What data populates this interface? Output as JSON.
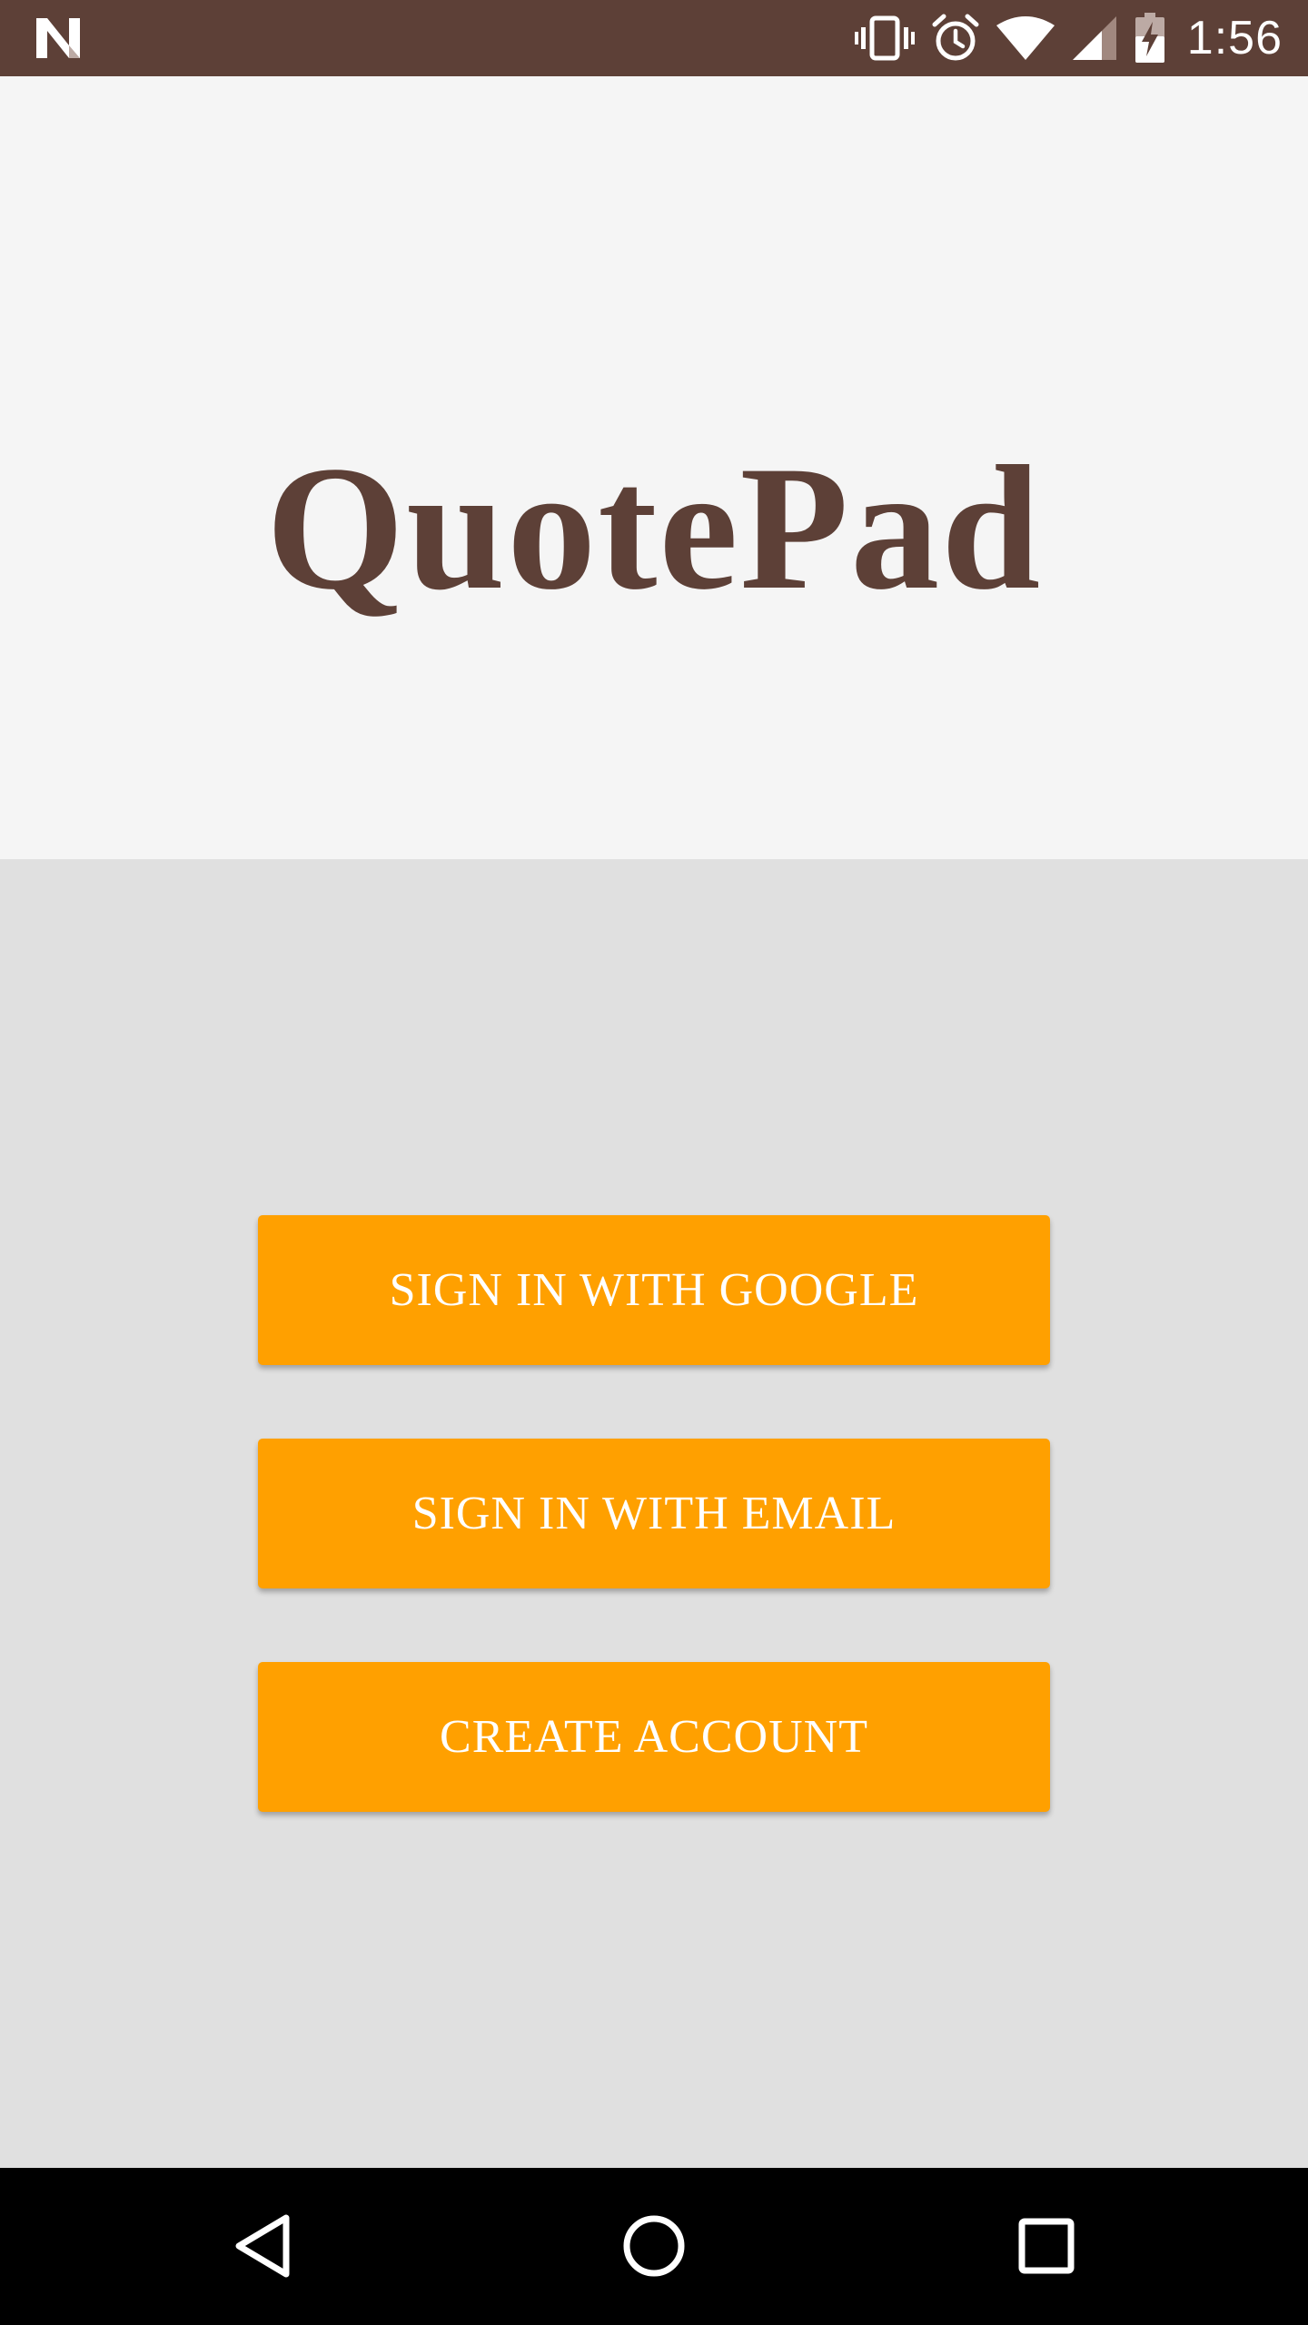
{
  "status_bar": {
    "time": "1:56",
    "background": "#5d4037",
    "icons": [
      "notification-n-icon",
      "vibrate-icon",
      "alarm-icon",
      "wifi-icon",
      "cell-signal-icon",
      "battery-charging-icon"
    ]
  },
  "header": {
    "app_title": "QuotePad",
    "title_color": "#5d4037",
    "background": "#f5f5f5"
  },
  "auth": {
    "background": "#e0e0e0",
    "accent": "#ffa000",
    "google_label": "SIGN IN WITH GOOGLE",
    "email_label": "SIGN IN WITH EMAIL",
    "create_label": "CREATE ACCOUNT"
  },
  "nav_bar": {
    "icons": [
      "back-icon",
      "home-icon",
      "recents-icon"
    ]
  }
}
